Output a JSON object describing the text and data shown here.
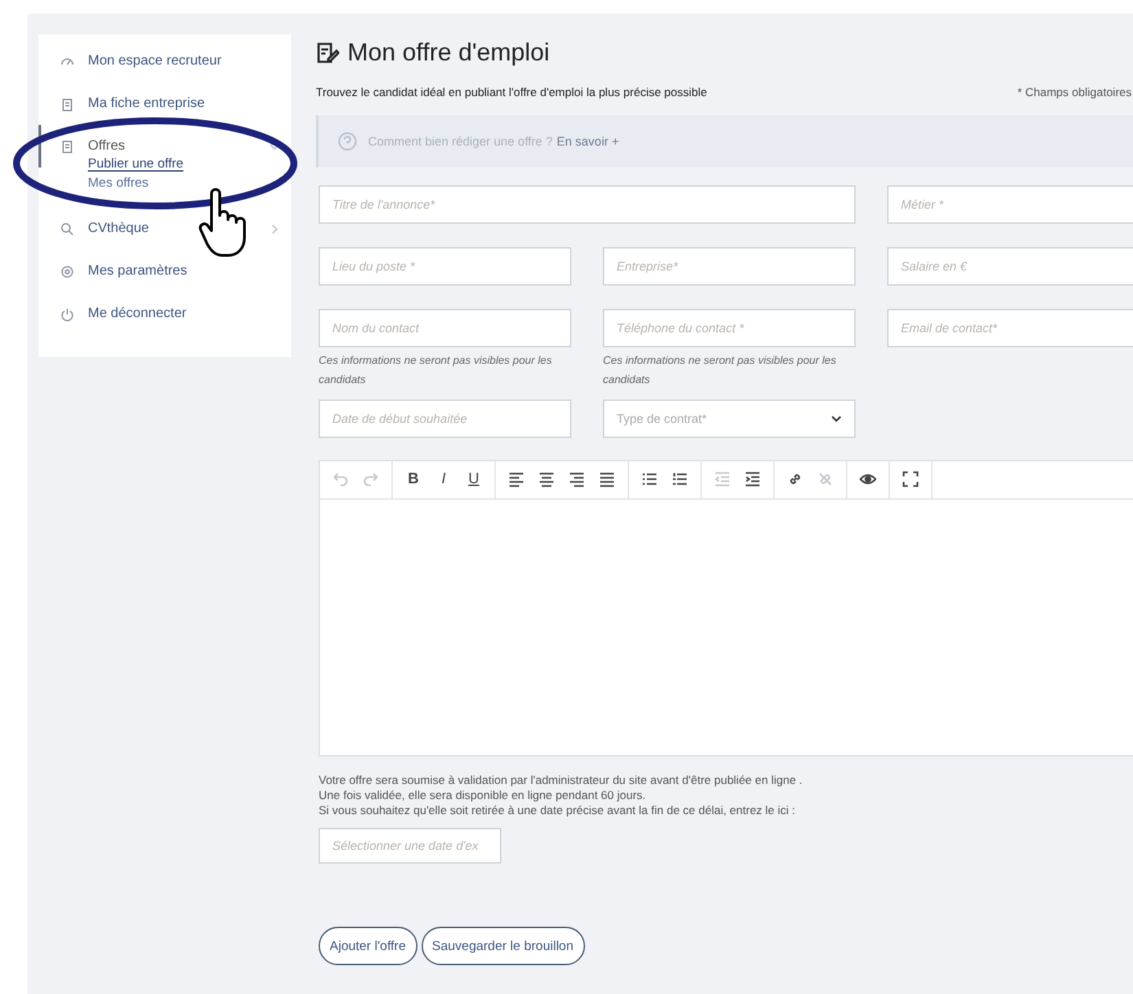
{
  "sidebar": {
    "items": [
      {
        "label": "Mon espace recruteur",
        "kind": "link"
      },
      {
        "label": "Ma fiche entreprise",
        "kind": "link"
      },
      {
        "label": "Offres",
        "kind": "group",
        "expanded": true,
        "children": [
          {
            "label": "Publier une offre",
            "selected": true
          },
          {
            "label": "Mes offres",
            "selected": false
          }
        ]
      },
      {
        "label": "CVthèque",
        "kind": "group",
        "expanded": false
      },
      {
        "label": "Mes paramètres",
        "kind": "link"
      },
      {
        "label": "Me déconnecter",
        "kind": "link"
      }
    ]
  },
  "page": {
    "title": "Mon offre d'emploi",
    "subtitle": "Trouvez le candidat idéal en publiant l'offre d'emploi la plus précise possible",
    "required_note": "* Champs obligatoires"
  },
  "tip": {
    "text": "Comment bien rédiger une offre ?",
    "link": "En savoir +"
  },
  "fields": [
    {
      "placeholder": "Titre de l'annonce*",
      "kind": "text"
    },
    {
      "placeholder": "Métier *",
      "kind": "text"
    },
    {
      "placeholder": "Lieu du poste *",
      "kind": "text"
    },
    {
      "placeholder": "Entreprise*",
      "kind": "text"
    },
    {
      "placeholder": "Salaire en €",
      "kind": "text"
    },
    {
      "placeholder": "Nom du contact",
      "kind": "text",
      "hint": "Ces informations ne seront pas visibles pour les candidats"
    },
    {
      "placeholder": "Téléphone du contact *",
      "kind": "text",
      "hint": "Ces informations ne seront pas visibles pour les candidats"
    },
    {
      "placeholder": "Email de contact*",
      "kind": "text"
    },
    {
      "placeholder": "Date de début souhaitée",
      "kind": "text"
    },
    {
      "placeholder": "Type de contrat*",
      "kind": "select"
    }
  ],
  "toolbar": [
    [
      {
        "kind": "undo",
        "disabled": true
      },
      {
        "kind": "redo",
        "disabled": true
      }
    ],
    [
      {
        "kind": "bold",
        "label": "B",
        "disabled": false
      },
      {
        "kind": "italic",
        "label": "I",
        "disabled": false
      },
      {
        "kind": "underline",
        "label": "U",
        "disabled": false
      }
    ],
    [
      {
        "kind": "align-left",
        "disabled": false
      },
      {
        "kind": "align-center",
        "disabled": false
      },
      {
        "kind": "align-right",
        "disabled": false
      },
      {
        "kind": "justify",
        "disabled": false
      }
    ],
    [
      {
        "kind": "bullets",
        "disabled": false
      },
      {
        "kind": "numbers",
        "disabled": false
      }
    ],
    [
      {
        "kind": "outdent",
        "disabled": true
      },
      {
        "kind": "indent",
        "disabled": false
      }
    ],
    [
      {
        "kind": "link",
        "disabled": false
      },
      {
        "kind": "unlink",
        "disabled": true
      }
    ],
    [
      {
        "kind": "preview",
        "disabled": false
      }
    ],
    [
      {
        "kind": "fullscreen",
        "disabled": false
      }
    ]
  ],
  "notice": [
    "Votre offre sera soumise à validation par l'administrateur du site avant d'être publiée en ligne .",
    "Une fois validée, elle sera disponible en ligne pendant 60 jours.",
    "Si vous souhaitez qu'elle soit retirée à une date précise avant la fin de ce délai, entrez le ici :"
  ],
  "expiry": {
    "placeholder": "Sélectionner une date d'ex"
  },
  "buttons": [
    "Ajouter l'offre",
    "Sauvegarder le brouillon"
  ]
}
